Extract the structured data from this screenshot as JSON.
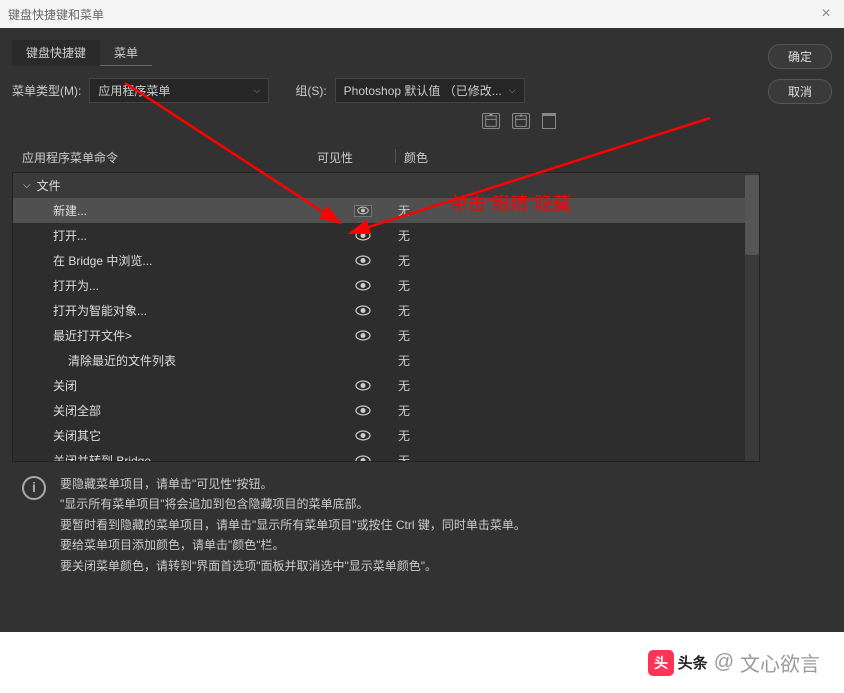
{
  "window": {
    "title": "键盘快捷键和菜单"
  },
  "buttons": {
    "ok": "确定",
    "cancel": "取消"
  },
  "tabs": {
    "shortcuts": "键盘快捷键",
    "menus": "菜单"
  },
  "menuType": {
    "label": "菜单类型(M):",
    "value": "应用程序菜单"
  },
  "set": {
    "label": "组(S):",
    "value": "Photoshop 默认值 （已修改..."
  },
  "headers": {
    "command": "应用程序菜单命令",
    "visibility": "可见性",
    "color": "颜色"
  },
  "tree": {
    "group": "文件",
    "items": [
      {
        "label": "新建...",
        "color": "无",
        "selected": true,
        "eye_boxed": true,
        "indent": 1
      },
      {
        "label": "打开...",
        "color": "无",
        "indent": 1
      },
      {
        "label": "在 Bridge 中浏览...",
        "color": "无",
        "indent": 1
      },
      {
        "label": "打开为...",
        "color": "无",
        "indent": 1
      },
      {
        "label": "打开为智能对象...",
        "color": "无",
        "indent": 1
      },
      {
        "label": "最近打开文件>",
        "color": "无",
        "indent": 1
      },
      {
        "label": "清除最近的文件列表",
        "color": "无",
        "no_eye": true,
        "indent": 2
      },
      {
        "label": "关闭",
        "color": "无",
        "indent": 1
      },
      {
        "label": "关闭全部",
        "color": "无",
        "indent": 1
      },
      {
        "label": "关闭其它",
        "color": "无",
        "indent": 1
      },
      {
        "label": "关闭并转到 Bridge...",
        "color": "无",
        "indent": 1
      }
    ]
  },
  "info": {
    "line1": "要隐藏菜单项目，请单击\"可见性\"按钮。",
    "line2": "\"显示所有菜单项目\"将会追加到包含隐藏项目的菜单底部。",
    "line3": "要暂时看到隐藏的菜单项目，请单击\"显示所有菜单项目\"或按住 Ctrl 键，同时单击菜单。",
    "line4": "要给菜单项目添加颜色，请单击\"颜色\"栏。",
    "line5": "要关闭菜单颜色，请转到\"界面首选项\"面板并取消选中\"显示菜单颜色\"。"
  },
  "annotation": {
    "text": "单击\"眼睛\"隐藏"
  },
  "footer": {
    "brand": "头条",
    "at": "@",
    "name": "文心欲言"
  }
}
